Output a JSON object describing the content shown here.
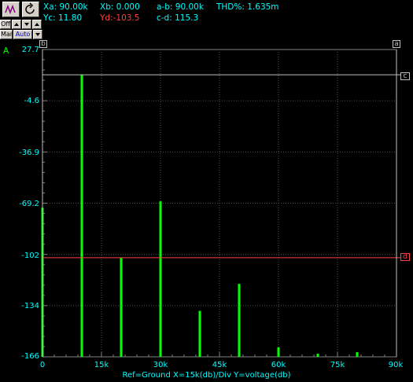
{
  "readouts": {
    "xa": "Xa: 90.00k",
    "xb": "Xb: 0.000",
    "a_b": "a-b: 90.00k",
    "thd": "THD%: 1.635m",
    "yc": "Yc: 11.80",
    "yd": "Yd:-103.5",
    "c_d": "c-d: 115.3"
  },
  "toolbar": {
    "off_label": "Off",
    "man_label": "Man",
    "auto_label": "Auto"
  },
  "channel_label": "A",
  "cursor_labels": {
    "a": "a",
    "b": "b",
    "c": "c",
    "d": "d"
  },
  "footer": "Ref=Ground  X=15k(db)/Div Y=voltage(db)",
  "colors": {
    "trace": "#00ff00",
    "cursor_c": "#c0c0c0",
    "cursor_d": "#ff4040",
    "text": "#00ffff",
    "grid": "#505050"
  },
  "chart_data": {
    "type": "bar",
    "xlabel": "X=15k(db)/Div",
    "ylabel": "Y=voltage(db)",
    "xlim": [
      0,
      90000
    ],
    "ylim": [
      -166,
      27.7
    ],
    "x_ticks": [
      "0",
      "15k",
      "30k",
      "45k",
      "60k",
      "75k",
      "90k"
    ],
    "y_ticks": [
      "27.7",
      "-4.6",
      "-36.9",
      "-69.2",
      "-102",
      "-134",
      "-166"
    ],
    "grid": true,
    "cursor_c_value": 11.8,
    "cursor_d_value": -103.5,
    "series": [
      {
        "x": [
          0,
          10000,
          20000,
          30000,
          40000,
          50000,
          60000,
          70000,
          80000
        ],
        "values": [
          -72,
          11.8,
          -103.5,
          -68,
          -137,
          -120,
          -160,
          -164,
          -163
        ]
      }
    ]
  }
}
